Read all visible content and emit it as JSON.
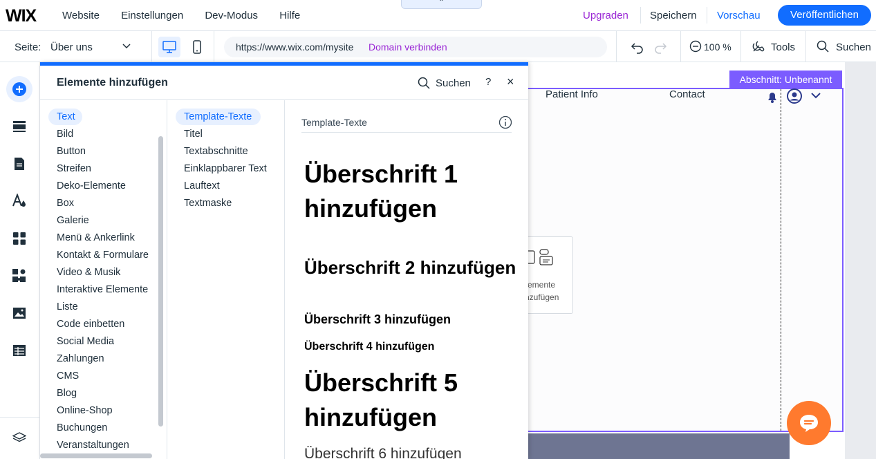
{
  "topbar": {
    "logo": "WIX",
    "nav": [
      "Website",
      "Einstellungen",
      "Dev-Modus",
      "Hilfe"
    ],
    "upgrade": "Upgraden",
    "save": "Speichern",
    "preview": "Vorschau",
    "publish": "Veröffentlichen",
    "handle_icon": "⌃"
  },
  "secondbar": {
    "page_label": "Seite:",
    "page_value": "Über uns",
    "url": "https://www.wix.com/mysite",
    "connect_domain": "Domain verbinden",
    "zoom": "100 %",
    "tools": "Tools",
    "search": "Suchen"
  },
  "panel": {
    "title": "Elemente hinzufügen",
    "search": "Suchen",
    "help": "?",
    "close": "×",
    "categories": [
      "Text",
      "Bild",
      "Button",
      "Streifen",
      "Deko-Elemente",
      "Box",
      "Galerie",
      "Menü & Ankerlink",
      "Kontakt & Formulare",
      "Video & Musik",
      "Interaktive Elemente",
      "Liste",
      "Code einbetten",
      "Social Media",
      "Zahlungen",
      "CMS",
      "Blog",
      "Online-Shop",
      "Buchungen",
      "Veranstaltungen"
    ],
    "subcategories": [
      "Template-Texte",
      "Titel",
      "Textabschnitte",
      "Einklappbarer Text",
      "Lauftext",
      "Textmaske"
    ],
    "preview_title": "Template-Texte",
    "headings": {
      "h1": "Überschrift 1 hinzufügen",
      "h2": "Überschrift 2 hinzufügen",
      "h3": "Überschrift 3 hinzufügen",
      "h4": "Überschrift 4 hinzufügen",
      "h5": "Überschrift 5 hinzufügen",
      "h6": "Überschrift 6 hinzufügen"
    }
  },
  "canvas": {
    "section_label": "Abschnitt: Unbenannt",
    "nav": [
      "Patient Info",
      "Contact"
    ],
    "placeholder": [
      "emente",
      "nzufügen"
    ]
  },
  "colors": {
    "accent": "#116dff",
    "upgrade": "#9a27d5",
    "section": "#7b5cff",
    "chat": "#ff7a2e"
  }
}
